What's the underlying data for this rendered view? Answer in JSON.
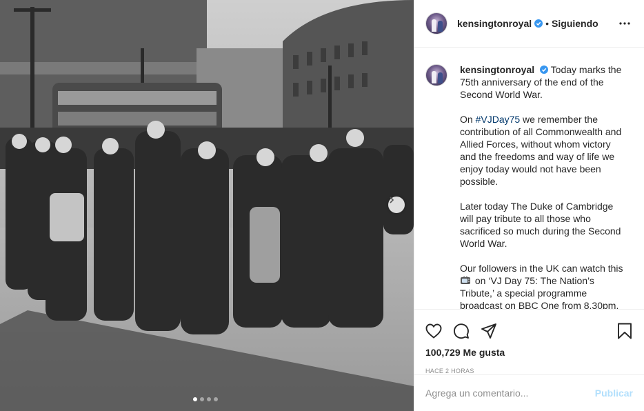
{
  "post": {
    "username": "kensingtonroyal",
    "follow_separator": "•",
    "follow_status": "Siguiendo",
    "caption_paragraphs": [
      {
        "before": "Today marks the 75th anniversary of the end of the Second World War."
      },
      {
        "prefix": "On ",
        "hashtag": "#VJDay75",
        "rest": " we remember the contribution of all Commonwealth and Allied Forces, without whom victory and the freedoms and way of life we enjoy today would not have been possible."
      },
      {
        "before": "Later today The Duke of Cambridge will pay tribute to all those who sacrificed so much during the Second World War."
      },
      {
        "prefix": "Our followers in the UK can watch this ",
        "rest": " on ‘VJ Day 75: The Nation’s Tribute,’ a special programme broadcast on BBC One from 8.30pm."
      }
    ],
    "likes": "100,729 Me gusta",
    "time_ago": "HACE 2 HORAS",
    "comment_placeholder": "Agrega un comentario...",
    "publish_label": "Publicar",
    "carousel": {
      "total": 4,
      "active_index": 0
    }
  },
  "icons": {
    "verified": "verified-badge-icon",
    "more": "more-options-icon",
    "like": "heart-icon",
    "comment": "comment-icon",
    "share": "paper-plane-icon",
    "save": "bookmark-icon",
    "next": "chevron-right-icon",
    "tv": "television-emoji-icon"
  },
  "colors": {
    "verified_blue": "#3897f0",
    "hashtag_link": "#00376b",
    "publish_disabled": "#b2dffc",
    "muted_text": "#8e8e8e",
    "border": "#efefef"
  }
}
